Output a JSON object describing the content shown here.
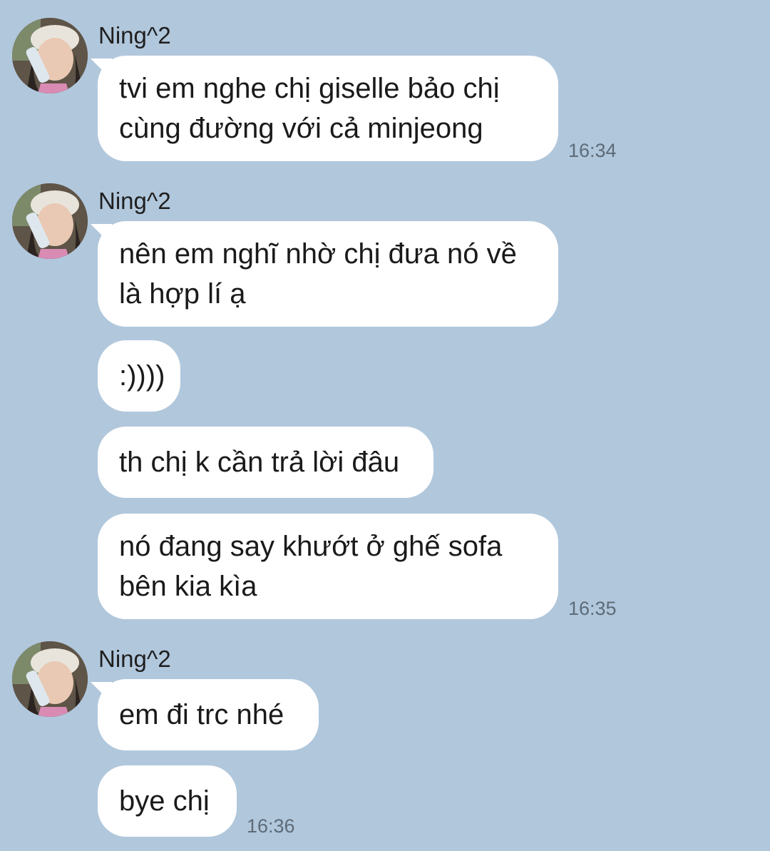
{
  "messages": [
    {
      "sender": "Ning^2",
      "text": "tvi em nghe chị giselle bảo chị cùng đường với cả minjeong",
      "time": "16:34"
    },
    {
      "sender": "Ning^2",
      "text": "nên em nghĩ nhờ chị đưa nó về là hợp lí ạ"
    },
    {
      "text": ":))))"
    },
    {
      "text": "th chị k cần trả lời đâu"
    },
    {
      "text": "nó đang say khướt ở ghế sofa bên kia kìa",
      "time": "16:35"
    },
    {
      "sender": "Ning^2",
      "text": "em đi trc nhé"
    },
    {
      "text": "bye chị",
      "time": "16:36"
    }
  ],
  "icons": {
    "avatar": "profile-photo-icon"
  },
  "colors": {
    "background": "#b1c7dc",
    "bubble": "#ffffff",
    "timestamp": "#5d6b78"
  }
}
